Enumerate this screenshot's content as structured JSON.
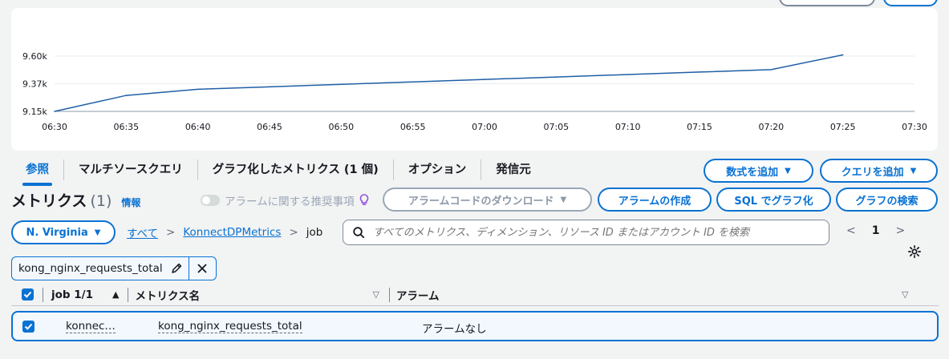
{
  "chart_data": {
    "type": "line",
    "x": [
      "06:30",
      "06:35",
      "06:40",
      "06:45",
      "06:50",
      "06:55",
      "07:00",
      "07:05",
      "07:10",
      "07:15",
      "07:20",
      "07:25"
    ],
    "values": [
      9150,
      9280,
      9330,
      9350,
      9370,
      9390,
      9410,
      9430,
      9450,
      9470,
      9490,
      9610
    ],
    "x_ticks": [
      "06:30",
      "06:35",
      "06:40",
      "06:45",
      "06:50",
      "06:55",
      "07:00",
      "07:05",
      "07:10",
      "07:15",
      "07:20",
      "07:25",
      "07:30"
    ],
    "y_ticks": [
      "9.15k",
      "9.37k",
      "9.60k"
    ],
    "y_tick_values": [
      9150,
      9375,
      9600
    ],
    "ylim": [
      9150,
      9600
    ],
    "grid": true,
    "color": "#1f5fa6"
  },
  "tabs": [
    {
      "label": "参照",
      "active": true
    },
    {
      "label": "マルチソースクエリ",
      "active": false
    },
    {
      "label": "グラフ化したメトリクス (1 個)",
      "active": false
    },
    {
      "label": "オプション",
      "active": false
    },
    {
      "label": "発信元",
      "active": false
    }
  ],
  "actions": {
    "add_math": "数式を追加",
    "add_query": "クエリを追加",
    "download_alarm_code": "アラームコードのダウンロード",
    "create_alarm": "アラームの作成",
    "graph_with_sql": "SQL でグラフ化",
    "search_graphs": "グラフの検索"
  },
  "metrics": {
    "title": "メトリクス",
    "count": "(1)",
    "info": "情報",
    "alarm_recommendations": "アラームに関する推奨事項"
  },
  "region": "N. Virginia",
  "breadcrumb": {
    "all": "すべて",
    "namespace": "KonnectDPMetrics",
    "dimension": "job"
  },
  "search": {
    "placeholder": "すべてのメトリクス、ディメンション、リソース ID またはアカウント ID を検索"
  },
  "pagination": {
    "current": "1"
  },
  "filter_token": "kong_nginx_requests_total",
  "table": {
    "headers": {
      "job": "job 1/1",
      "metric_name": "メトリクス名",
      "alarm": "アラーム"
    },
    "rows": [
      {
        "job": "konnec…",
        "metric_name": "kong_nginx_requests_total",
        "alarm": "アラームなし",
        "selected": true
      }
    ]
  },
  "colors": {
    "accent": "#0972d3",
    "text": "#16191f",
    "muted": "#5f6b7a"
  }
}
